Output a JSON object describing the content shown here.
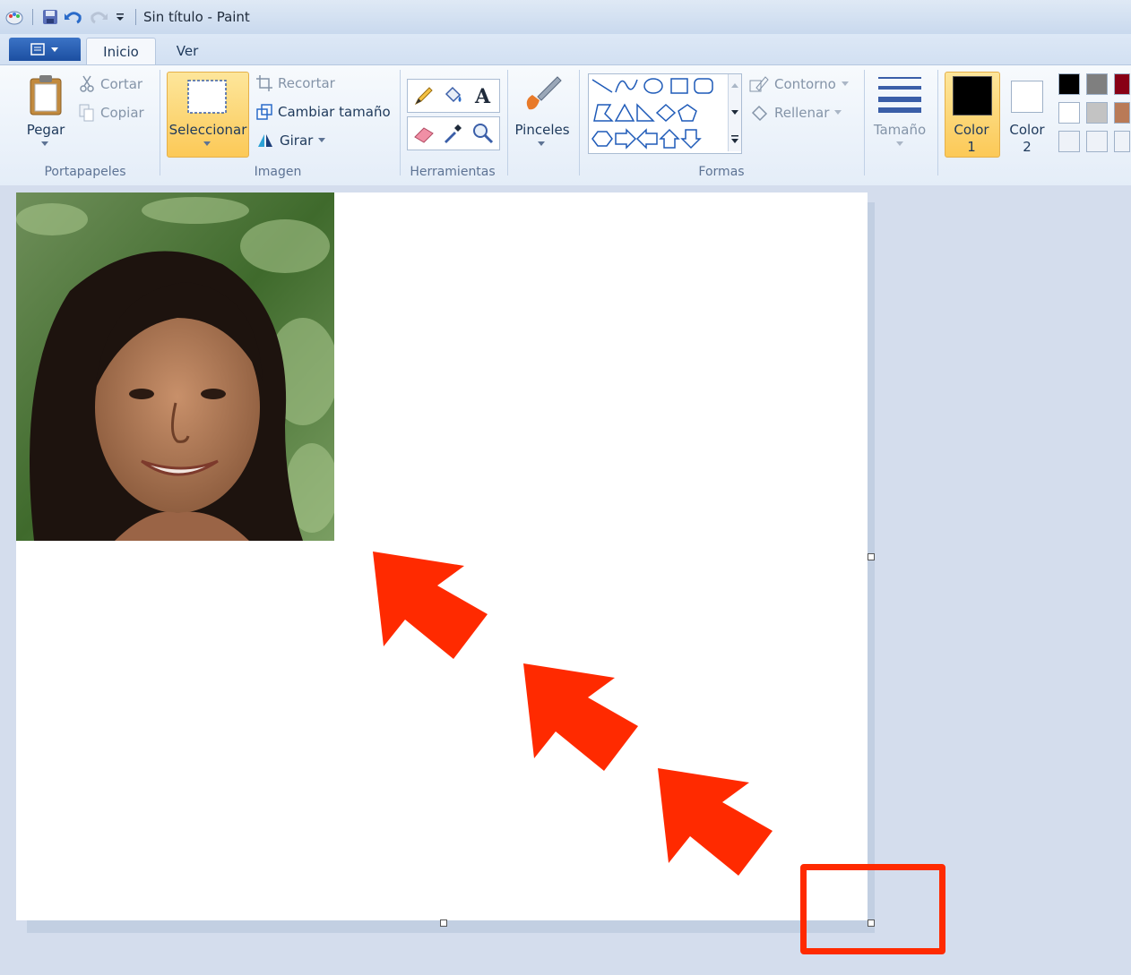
{
  "window": {
    "title": "Sin título - Paint"
  },
  "quick_access": {
    "icons": [
      "paint-app-icon",
      "save-icon",
      "undo-icon",
      "redo-icon",
      "customize-dropdown-icon"
    ]
  },
  "tabs": [
    {
      "label": "Inicio",
      "active": true
    },
    {
      "label": "Ver",
      "active": false
    }
  ],
  "ribbon": {
    "clipboard": {
      "paste_label": "Pegar",
      "cut_label": "Cortar",
      "copy_label": "Copiar",
      "group_label": "Portapapeles"
    },
    "image": {
      "select_label": "Seleccionar",
      "crop_label": "Recortar",
      "resize_label": "Cambiar tamaño",
      "rotate_label": "Girar",
      "group_label": "Imagen"
    },
    "tools": {
      "group_label": "Herramientas",
      "items": [
        "pencil-icon",
        "fill-bucket-icon",
        "text-icon",
        "eraser-icon",
        "color-picker-icon",
        "magnifier-icon"
      ]
    },
    "brushes": {
      "label": "Pinceles"
    },
    "shapes": {
      "outline_label": "Contorno",
      "fill_label": "Rellenar",
      "group_label": "Formas"
    },
    "size": {
      "label": "Tamaño"
    },
    "colors": {
      "color1_label": "Color",
      "color1_num": "1",
      "color2_label": "Color",
      "color2_num": "2",
      "color1_value": "#000000",
      "color2_value": "#ffffff",
      "palette": [
        "#000000",
        "#7f7f7f",
        "#880015",
        "#ffffff",
        "#c3c3c3",
        "#b97a57"
      ]
    }
  },
  "canvas": {
    "background": "#ffffff",
    "annotation_color": "#ff2a00",
    "photo_description_icon": "woman-portrait-photo"
  }
}
